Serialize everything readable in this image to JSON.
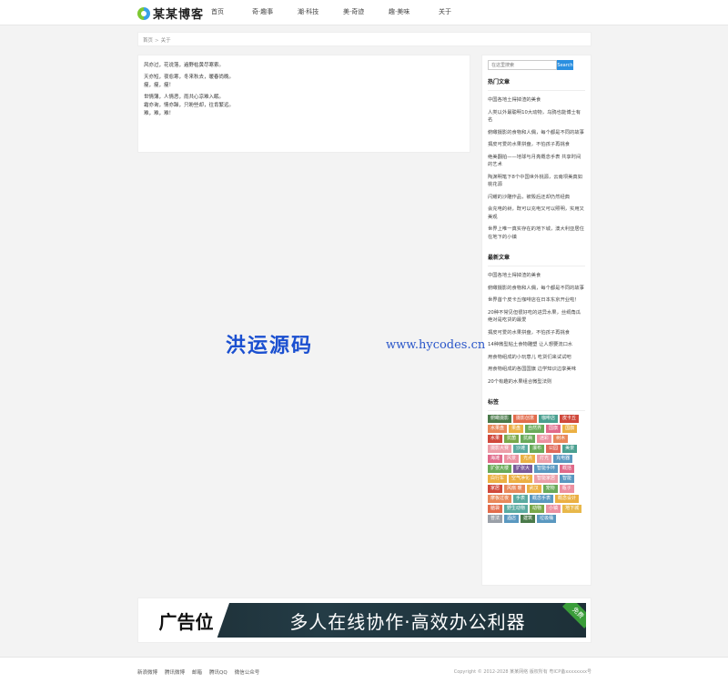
{
  "header": {
    "site_name": "某某博客",
    "nav": [
      "首页",
      "奇·趣事",
      "潮·科技",
      "美·奇迹",
      "趣·美味",
      "关于"
    ]
  },
  "breadcrumb": {
    "home": "首页",
    "separator": ">",
    "current": "关于"
  },
  "article": {
    "paragraphs": [
      "风亦过，花说落，遍野枯黄尽寒索。",
      "天亦短，夜愈寒，冬来秋去，暖春尚晚。\n瘦，瘦，瘦！",
      "世情薄，人情恶，雨共心凉难入眠。\n霜亦询，情亦躁，只盼些却，往肯繁远。\n难，难，难！"
    ]
  },
  "sidebar": {
    "search_placeholder": "在这里搜索",
    "search_button": "Search",
    "hot_title": "热门文章",
    "hot_posts": [
      "中国各地土得掉渣的美食",
      "人类以外最聪明10大动物，乌鸦也能博士有名",
      "俯瞰摄影的食物和人偶，每个都是不同的故事",
      "捐皮可爱的水果拼盘，不怕孩子再挑食",
      "绝美翻拍——地球与月亮概念手表 共享时间的艺术",
      "陶渊明笔下8个中国世外桃源，云南坝美真如桃花源",
      "闪耀的沙雕作品，被毁后还却仍然经典",
      "会充电的树，既可以充电又可以照明，实用又美观",
      "世界上唯一真实存在的地下城，澳大利亚居住在地下的小镇"
    ],
    "latest_title": "最新文章",
    "latest_posts": [
      "中国各地土得掉渣的美食",
      "俯瞰摄影的食物和人偶，每个都是不同的故事",
      "世界首个皮卡丘咖啡店在日本东京开业啦！",
      "20种不常见但很好吃的进异水果，丝绸角瓜绝对是吃货的最爱",
      "捐皮可爱的水果拼盘，不怕孩子再挑食",
      "14种微型粘土食物雕塑 让人想要流口水",
      "用食物组成的小玩意儿 吃货们来试试吧",
      "用食物组成的各国国旗 边学知识边享美味",
      "20个有趣的水果组合微型法则"
    ],
    "tags_title": "标签",
    "tags": [
      {
        "t": "俯瞰摄影",
        "c": "#4a7a4a"
      },
      {
        "t": "摄影创意",
        "c": "#e26c4c"
      },
      {
        "t": "咖啡店",
        "c": "#4aa090"
      },
      {
        "t": "皮卡丘",
        "c": "#d0493c"
      },
      {
        "t": "水果盘",
        "c": "#e8885a"
      },
      {
        "t": "果盘",
        "c": "#ebb043"
      },
      {
        "t": "自然界",
        "c": "#6aaa5a"
      },
      {
        "t": "国旗",
        "c": "#e06a8a"
      },
      {
        "t": "国旗",
        "c": "#ebb043"
      },
      {
        "t": "水果",
        "c": "#d0493c"
      },
      {
        "t": "抗菌",
        "c": "#7aa84a"
      },
      {
        "t": "抗病",
        "c": "#6aaa5a"
      },
      {
        "t": "迷彩",
        "c": "#ec90a0"
      },
      {
        "t": "树木",
        "c": "#e8885a"
      },
      {
        "t": "摄影大赛",
        "c": "#ec9ea8"
      },
      {
        "t": "沙滩",
        "c": "#5aaaa0"
      },
      {
        "t": "瀑布",
        "c": "#6aaa5a"
      },
      {
        "t": "公园",
        "c": "#e06a5a"
      },
      {
        "t": "美景",
        "c": "#4aa090"
      },
      {
        "t": "海滩",
        "c": "#e06a8a"
      },
      {
        "t": "风景",
        "c": "#ec90a0"
      },
      {
        "t": "光点",
        "c": "#ebb043"
      },
      {
        "t": "灯光",
        "c": "#ec9ea8"
      },
      {
        "t": "充电器",
        "c": "#5a98c0"
      },
      {
        "t": "扩张大楼",
        "c": "#6aaa5a"
      },
      {
        "t": "扩张大",
        "c": "#7a5a9a"
      },
      {
        "t": "智能手环",
        "c": "#5a98c0"
      },
      {
        "t": "概括",
        "c": "#e06a8a"
      },
      {
        "t": "白行车",
        "c": "#ebb043"
      },
      {
        "t": "空气净化",
        "c": "#ebb043"
      },
      {
        "t": "智能家居",
        "c": "#ec9ea8"
      },
      {
        "t": "智能",
        "c": "#5a98c0"
      },
      {
        "t": "家居",
        "c": "#d0493c"
      },
      {
        "t": "风扇 暖",
        "c": "#e8885a"
      },
      {
        "t": "武汉",
        "c": "#ebb043"
      },
      {
        "t": "宠物",
        "c": "#6aaa5a"
      },
      {
        "t": "瓶子",
        "c": "#ec90a0"
      },
      {
        "t": "摩板过夜",
        "c": "#e8885a"
      },
      {
        "t": "手表",
        "c": "#5aaaa0"
      },
      {
        "t": "概念手表",
        "c": "#5a98c0"
      },
      {
        "t": "概念设计",
        "c": "#ebb043"
      },
      {
        "t": "脑袋",
        "c": "#e26c4c"
      },
      {
        "t": "野生动物",
        "c": "#5aaaa0"
      },
      {
        "t": "动物",
        "c": "#7aa84a"
      },
      {
        "t": "小镇",
        "c": "#ec90a0"
      },
      {
        "t": "地下城",
        "c": "#e8b84a"
      },
      {
        "t": "普法",
        "c": "#9aa0a8"
      },
      {
        "t": "酒店",
        "c": "#5a98c0"
      },
      {
        "t": "建筑",
        "c": "#4a7a4a"
      },
      {
        "t": "垃圾桶",
        "c": "#5a98c0"
      }
    ]
  },
  "ad": {
    "label": "广告位",
    "text": "多人在线协作·高效办公利器",
    "badge": "免费"
  },
  "watermark": {
    "cn": "洪运源码",
    "url": "www.hycodes.cn"
  },
  "footer": {
    "links": [
      "新浪微博",
      "腾讯微博",
      "邮箱",
      "腾讯QQ",
      "微信公众号"
    ],
    "copyright": "Copyright © 2012-2028 某某网络 版权所有 粤ICP备xxxxxxxx号"
  }
}
